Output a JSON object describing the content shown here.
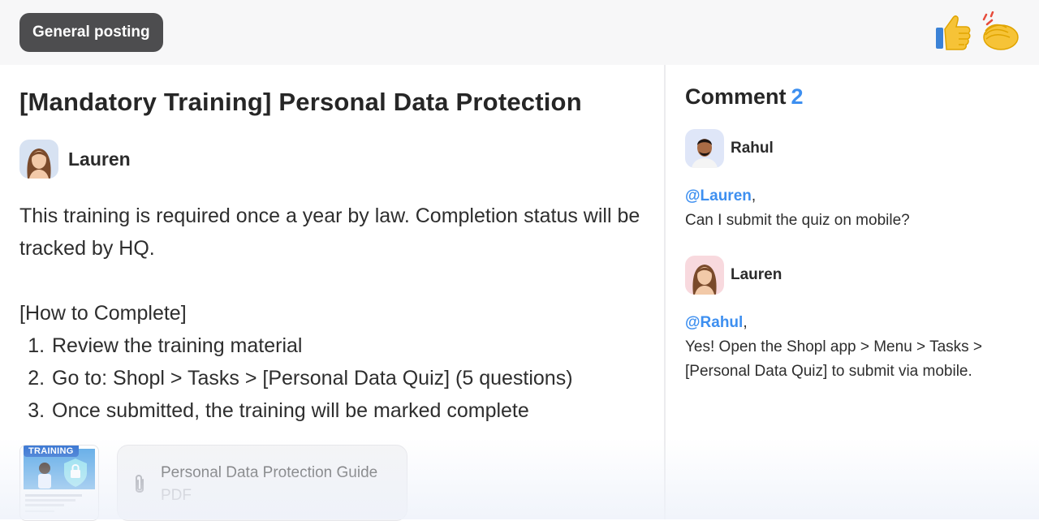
{
  "category_tag": "General posting",
  "reactions": [
    {
      "icon": "thumbs-up-icon"
    },
    {
      "icon": "clapping-hands-icon"
    }
  ],
  "post": {
    "title": "[Mandatory Training] Personal Data Protection",
    "author": "Lauren",
    "intro": "This training is required once a year by law. Completion status will be tracked by HQ.",
    "section_heading": "[How to Complete]",
    "steps": [
      "Review the training material",
      "Go to: Shopl > Tasks > [Personal Data Quiz] (5 questions)",
      "Once submitted, the training will be marked complete"
    ],
    "attachment_thumb_label": "TRAINING",
    "attachment": {
      "name": "Personal Data Protection Guide",
      "type": "PDF"
    }
  },
  "comments_panel": {
    "title": "Comment",
    "count": "2",
    "items": [
      {
        "author": "Rahul",
        "mention": "@Lauren",
        "punct": ",",
        "text": "Can I submit the quiz on mobile?"
      },
      {
        "author": "Lauren",
        "mention": "@Rahul",
        "punct": ",",
        "text": "Yes! Open the Shopl app > Menu > Tasks > [Personal Data Quiz] to submit via mobile."
      }
    ]
  },
  "colors": {
    "accent": "#3d8ff0",
    "tag_bg": "#4d4d4f"
  }
}
